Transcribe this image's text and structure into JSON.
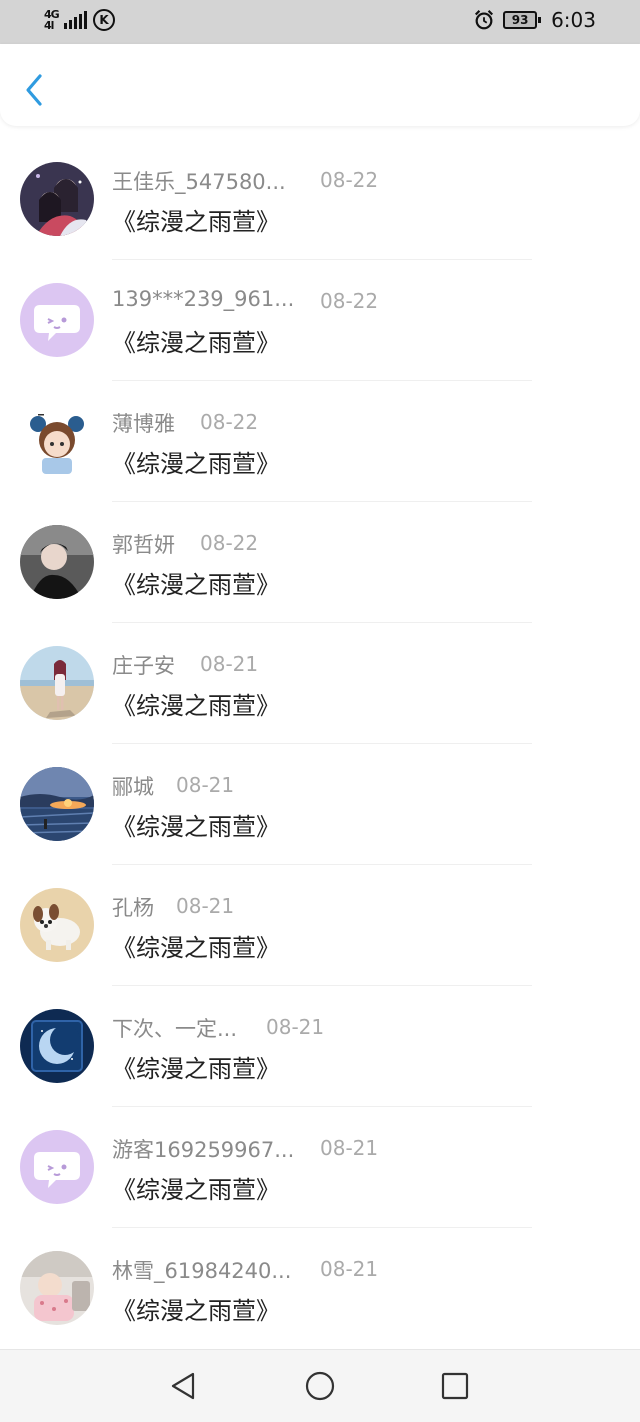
{
  "status_bar": {
    "network": "4G",
    "network_sub": "4l",
    "carrier_badge": "K",
    "battery": "93",
    "time": "6:03",
    "icons": [
      "signal-icon",
      "k-badge-icon",
      "alarm-icon",
      "battery-icon"
    ]
  },
  "header": {
    "back_icon": "chevron-left-icon",
    "accent": "#2f9be0"
  },
  "items": [
    {
      "name": "王佳乐_547580...",
      "date": "08-22",
      "title": "《综漫之雨萱》",
      "avatar": "anime-couple"
    },
    {
      "name": "139***239_961...",
      "date": "08-22",
      "title": "《综漫之雨萱》",
      "avatar": "default-chat"
    },
    {
      "name": "薄博雅",
      "date": "08-22",
      "title": "《综漫之雨萱》",
      "avatar": "cartoon-girl"
    },
    {
      "name": "郭哲妍",
      "date": "08-22",
      "title": "《综漫之雨萱》",
      "avatar": "portrait-man"
    },
    {
      "name": "庄子安",
      "date": "08-21",
      "title": "《综漫之雨萱》",
      "avatar": "beach-girl"
    },
    {
      "name": "郦城",
      "date": "08-21",
      "title": "《综漫之雨萱》",
      "avatar": "sunset-sea"
    },
    {
      "name": "孔杨",
      "date": "08-21",
      "title": "《综漫之雨萱》",
      "avatar": "puppy"
    },
    {
      "name": "下次、一定...",
      "date": "08-21",
      "title": "《综漫之雨萱》",
      "avatar": "moon"
    },
    {
      "name": "游客169259967...",
      "date": "08-21",
      "title": "《综漫之雨萱》",
      "avatar": "default-chat"
    },
    {
      "name": "林雪_61984240...",
      "date": "08-21",
      "title": "《综漫之雨萱》",
      "avatar": "baby-photo"
    }
  ],
  "nav_bar": {
    "icons": [
      "back-triangle-icon",
      "home-circle-icon",
      "recents-square-icon"
    ]
  }
}
